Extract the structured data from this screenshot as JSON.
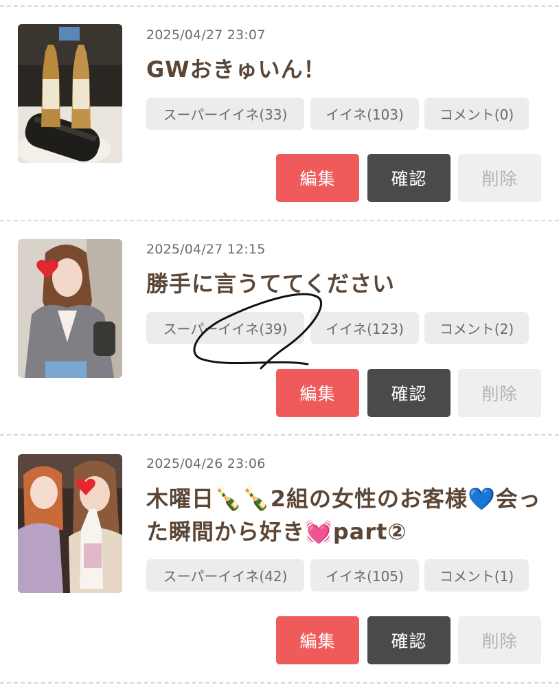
{
  "posts": [
    {
      "date": "2025/04/27 23:07",
      "title": "GWおきゅいん！",
      "super_like": "スーパーイイネ(33)",
      "like": "イイネ(103)",
      "comment": "コメント(0)",
      "edit": "編集",
      "confirm": "確認",
      "delete": "削除"
    },
    {
      "date": "2025/04/27 12:15",
      "title": "勝手に言うててください",
      "super_like": "スーパーイイネ(39)",
      "like": "イイネ(123)",
      "comment": "コメント(2)",
      "edit": "編集",
      "confirm": "確認",
      "delete": "削除"
    },
    {
      "date": "2025/04/26 23:06",
      "title": "木曜日🍾🍾2組の女性のお客様💙会った瞬間から好き💓part②",
      "super_like": "スーパーイイネ(42)",
      "like": "イイネ(105)",
      "comment": "コメント(1)",
      "edit": "編集",
      "confirm": "確認",
      "delete": "削除"
    }
  ],
  "colors": {
    "edit_button": "#ef5b5b",
    "confirm_button": "#4a4a4a",
    "delete_button": "#efefef",
    "chip_background": "#ececec",
    "title_text": "#5b4535"
  },
  "icons": {
    "heart_sticker": "red-heart-icon"
  }
}
